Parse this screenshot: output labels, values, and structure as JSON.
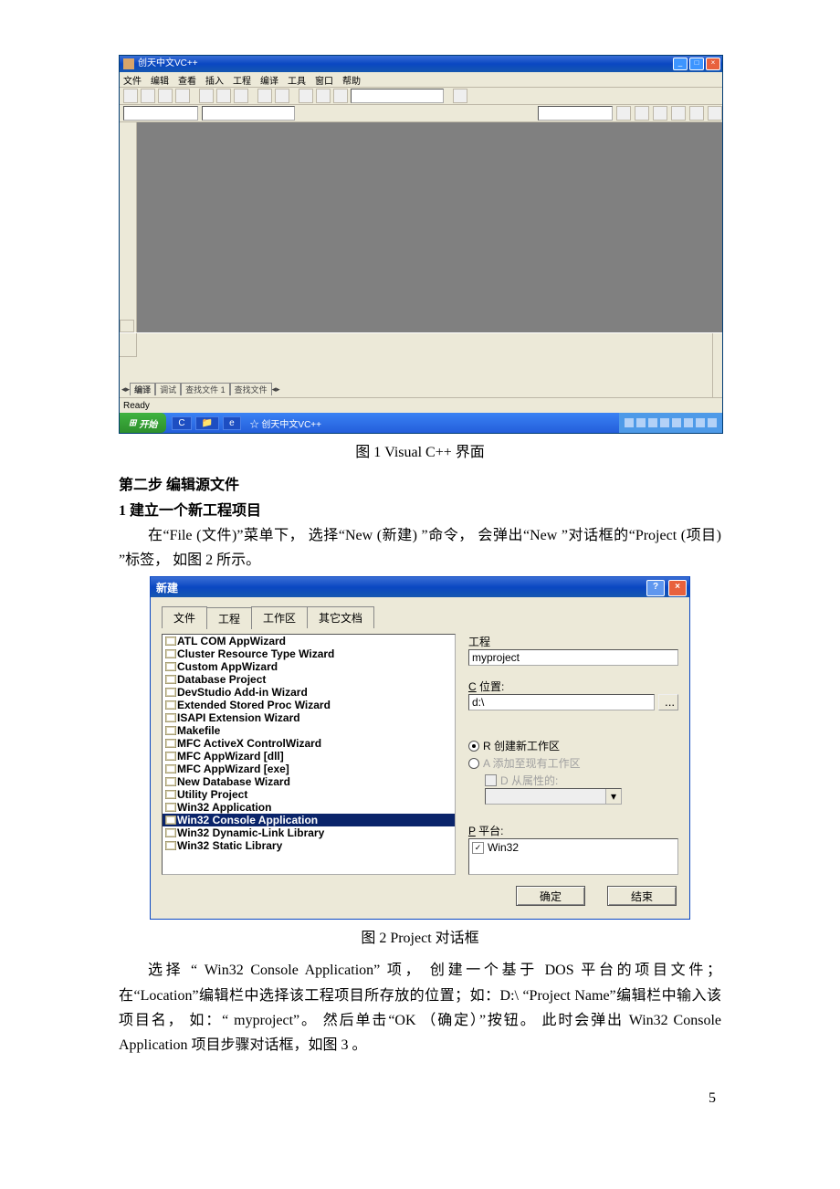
{
  "vc": {
    "title": "创天中文VC++",
    "menus": [
      "文件",
      "编辑",
      "查看",
      "插入",
      "工程",
      "编译",
      "工具",
      "窗口",
      "帮助"
    ],
    "status": "Ready",
    "output_tabs": [
      "编译",
      "调试",
      "查找文件 1",
      "查找文件",
      ""
    ],
    "taskbar": {
      "start": "开始",
      "task": "☆ 创天中文VC++"
    }
  },
  "caption1": "图 1    Visual C++  界面",
  "h1": "第二步  编辑源文件",
  "h2": "1  建立一个新工程项目",
  "para1": "在“File (文件)”菜单下， 选择“New (新建) ”命令， 会弹出“New ”对话框的“Project (项目) ”标签， 如图 2 所示。",
  "dlg": {
    "title": "新建",
    "tabs": [
      "文件",
      "工程",
      "工作区",
      "其它文档"
    ],
    "items": [
      "ATL COM AppWizard",
      "Cluster Resource Type Wizard",
      "Custom AppWizard",
      "Database Project",
      "DevStudio Add-in Wizard",
      "Extended Stored Proc Wizard",
      "ISAPI Extension Wizard",
      "Makefile",
      "MFC ActiveX ControlWizard",
      "MFC AppWizard [dll]",
      "MFC AppWizard [exe]",
      "New Database Wizard",
      "Utility Project",
      "Win32 Application",
      "Win32 Console Application",
      "Win32 Dynamic-Link Library",
      "Win32 Static Library"
    ],
    "sel_index": 14,
    "lbl_proj": "工程",
    "proj": "myproject",
    "lbl_loc_prefix": "C",
    "lbl_loc_rest": " 位置:",
    "loc": "d:\\",
    "browse": "...",
    "radio_new_prefix": "R",
    "radio_new_rest": " 创建新工作区",
    "radio_add_prefix": "A",
    "radio_add_rest": " 添加至现有工作区",
    "chk_dep_prefix": "D",
    "chk_dep_rest": " 从属性的:",
    "lbl_plat_prefix": "P",
    "lbl_plat_rest": " 平台:",
    "plat_opt": "Win32",
    "ok": "确定",
    "cancel": "结束"
  },
  "caption2": "图 2    Project 对话框",
  "para2": "选择 “ Win32 Console Application” 项， 创建一个基于 DOS 平台的项目文件；在“Location”编辑栏中选择该工程项目所存放的位置；如：D:\\     “Project Name”编辑栏中输入该项目名， 如：“ myproject”。 然后单击“OK （确定）”按钮。 此时会弹出 Win32 Console Application  项目步骤对话框，如图 3 。",
  "page_num": "5"
}
